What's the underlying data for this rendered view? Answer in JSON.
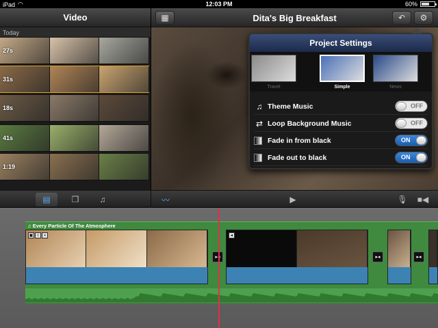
{
  "status": {
    "device": "iPad",
    "time": "12:03 PM",
    "battery": "60%",
    "battery_level": 0.6
  },
  "browser": {
    "title": "Video",
    "section": "Today",
    "clips": [
      {
        "duration": "27s",
        "colors": [
          "#c4a987",
          "#d8c2a8",
          "#a8a8a0"
        ]
      },
      {
        "duration": "31s",
        "colors": [
          "#8a6a48",
          "#b08556",
          "#c9a470"
        ],
        "selected": true
      },
      {
        "duration": "18s",
        "colors": [
          "#6b5a45",
          "#8a7a68",
          "#5c4a3a"
        ]
      },
      {
        "duration": "41s",
        "colors": [
          "#5a7a40",
          "#9ab06a",
          "#b4a898"
        ]
      },
      {
        "duration": "1:19",
        "colors": [
          "#9a8060",
          "#8a7050",
          "#6a8048"
        ]
      }
    ]
  },
  "viewer": {
    "title": "Dita's Big Breakfast"
  },
  "project_settings": {
    "title": "Project Settings",
    "themes": [
      {
        "label": "Travel",
        "color": "#8a8a8a"
      },
      {
        "label": "Simple",
        "color": "#4a70b8"
      },
      {
        "label": "News",
        "color": "#2a4a8a"
      }
    ],
    "settings": [
      {
        "label": "Theme Music",
        "state": "OFF",
        "on": false,
        "icon": "music-note-icon"
      },
      {
        "label": "Loop Background Music",
        "state": "OFF",
        "on": false,
        "icon": "loop-icon"
      },
      {
        "label": "Fade in from black",
        "state": "ON",
        "on": true,
        "icon": "fade-icon"
      },
      {
        "label": "Fade out to black",
        "state": "ON",
        "on": true,
        "icon": "fade-icon"
      }
    ]
  },
  "timeline": {
    "music_title": "Every Particle Of The Atmosphere",
    "accent": "#e0304a"
  }
}
